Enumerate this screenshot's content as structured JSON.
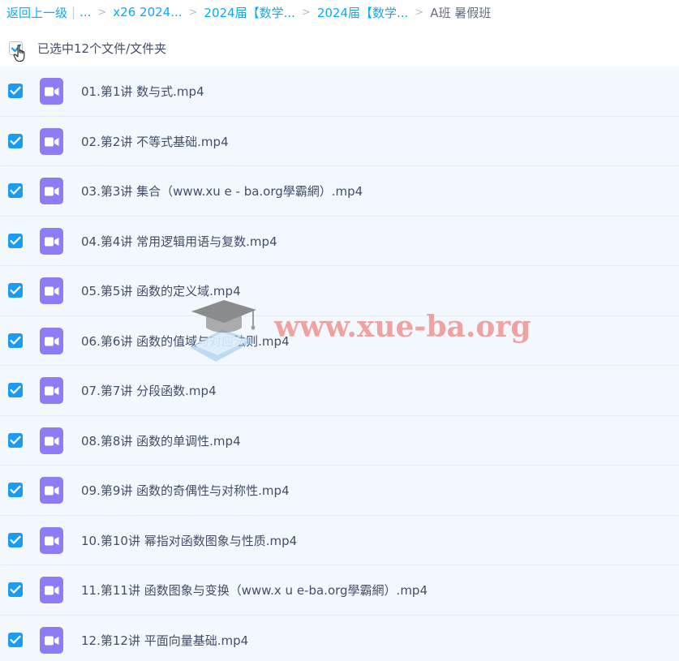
{
  "breadcrumb": {
    "back": "返回上一级",
    "ellipsis": "...",
    "items": [
      "x26 2024...",
      "2024届【数学...",
      "2024届【数学..."
    ],
    "current": "A班 暑假班"
  },
  "selection": {
    "text": "已选中12个文件/文件夹"
  },
  "files": [
    {
      "name": "01.第1讲 数与式.mp4"
    },
    {
      "name": "02.第2讲 不等式基础.mp4"
    },
    {
      "name": "03.第3讲 集合（www.xu e - ba.org學霸網）.mp4"
    },
    {
      "name": "04.第4讲 常用逻辑用语与复数.mp4"
    },
    {
      "name": "05.第5讲 函数的定义域.mp4"
    },
    {
      "name": "06.第6讲 函数的值域与对应法则.mp4"
    },
    {
      "name": "07.第7讲 分段函数.mp4"
    },
    {
      "name": "08.第8讲 函数的单调性.mp4"
    },
    {
      "name": "09.第9讲 函数的奇偶性与对称性.mp4"
    },
    {
      "name": "10.第10讲 幂指对函数图象与性质.mp4"
    },
    {
      "name": "11.第11讲 函数图象与变换（www.x u e-ba.org學霸網）.mp4"
    },
    {
      "name": "12.第12讲 平面向量基础.mp4"
    }
  ],
  "watermark": {
    "text": "www.xue-ba.org"
  },
  "colors": {
    "accent": "#09aaff",
    "checkbox": "#1a9cf5",
    "video_icon": "#8d7cf3",
    "row_bg": "#f3f8fe"
  }
}
